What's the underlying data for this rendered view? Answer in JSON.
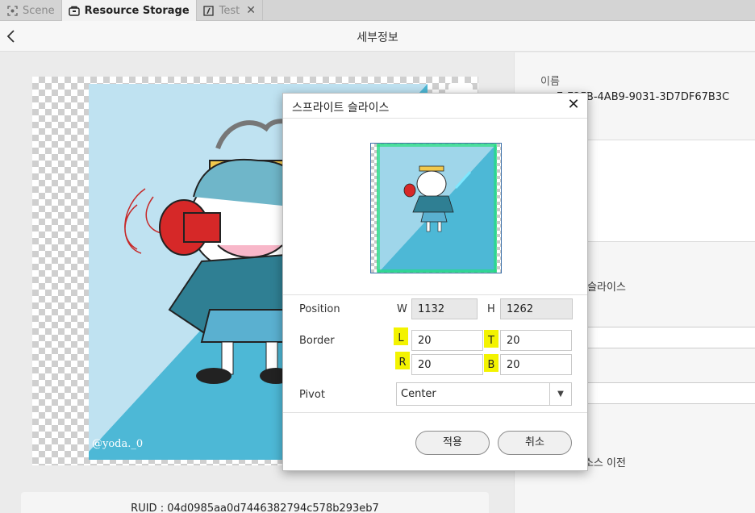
{
  "tabs": [
    {
      "label": "Scene",
      "icon": "scene-icon",
      "active": false
    },
    {
      "label": "Resource Storage",
      "icon": "storage-icon",
      "active": true
    },
    {
      "label": "Test",
      "icon": "script-icon",
      "active": false,
      "close": "✕"
    }
  ],
  "header": {
    "title": "세부정보"
  },
  "preview": {
    "watermark": "@yoda._0",
    "ruid": "RUID : 04d0985aa0d7446382794c578b293eb7"
  },
  "right_panel": {
    "name_label": "이름",
    "name_value": "7-E2FB-4AB9-9031-3D7DF67B3C",
    "slice_label": "트 슬라이스",
    "move_label": "리소스 이전"
  },
  "dialog": {
    "title": "스프라이트 슬라이스",
    "position_label": "Position",
    "w_label": "W",
    "w_value": "1132",
    "h_label": "H",
    "h_value": "1262",
    "border_label": "Border",
    "l_label": "L",
    "l_value": "20",
    "t_label": "T",
    "t_value": "20",
    "r_label": "R",
    "r_value": "20",
    "b_label": "B",
    "b_value": "20",
    "pivot_label": "Pivot",
    "pivot_value": "Center",
    "apply_label": "적용",
    "cancel_label": "취소"
  },
  "colors": {
    "highlight": "#f3f300",
    "sprite_bg_light": "#bfe2f1",
    "sprite_bg_dark": "#4db8d6",
    "slice_guide": "#22e07a"
  }
}
